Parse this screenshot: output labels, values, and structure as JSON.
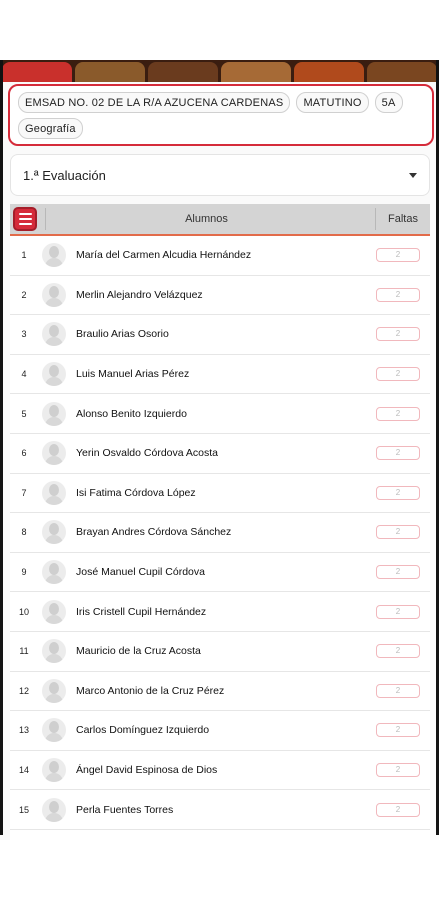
{
  "banner": {
    "tiles": [
      "#c9302c",
      "#8a5a2b",
      "#6a3b1e",
      "#a66a36",
      "#b04a1c",
      "#7a4620"
    ]
  },
  "header": {
    "chips": [
      "EMSAD NO. 02 DE LA R/A AZUCENA CARDENAS",
      "MATUTINO",
      "5A",
      "Geografía"
    ],
    "accent_color": "#d52b3a"
  },
  "evaluation": {
    "selected": "1.ª Evaluación"
  },
  "table": {
    "columns": {
      "students": "Alumnos",
      "absences": "Faltas"
    },
    "rows": [
      {
        "num": "1",
        "name": "María del Carmen Alcudia Hernández",
        "faltas": "2"
      },
      {
        "num": "2",
        "name": "Merlin Alejandro Velázquez",
        "faltas": "2"
      },
      {
        "num": "3",
        "name": "Braulio Arias Osorio",
        "faltas": "2"
      },
      {
        "num": "4",
        "name": "Luis Manuel Arias Pérez",
        "faltas": "2"
      },
      {
        "num": "5",
        "name": "Alonso Benito Izquierdo",
        "faltas": "2"
      },
      {
        "num": "6",
        "name": "Yerin Osvaldo Córdova Acosta",
        "faltas": "2"
      },
      {
        "num": "7",
        "name": "Isi Fatima Córdova López",
        "faltas": "2"
      },
      {
        "num": "8",
        "name": "Brayan Andres Córdova Sánchez",
        "faltas": "2"
      },
      {
        "num": "9",
        "name": "José Manuel Cupil Córdova",
        "faltas": "2"
      },
      {
        "num": "10",
        "name": "Iris Cristell Cupil Hernández",
        "faltas": "2"
      },
      {
        "num": "11",
        "name": "Mauricio de la Cruz Acosta",
        "faltas": "2"
      },
      {
        "num": "12",
        "name": "Marco Antonio de la Cruz Pérez",
        "faltas": "2"
      },
      {
        "num": "13",
        "name": "Carlos Domínguez Izquierdo",
        "faltas": "2"
      },
      {
        "num": "14",
        "name": "Ángel David Espinosa de Dios",
        "faltas": "2"
      },
      {
        "num": "15",
        "name": "Perla Fuentes Torres",
        "faltas": "2"
      }
    ]
  }
}
